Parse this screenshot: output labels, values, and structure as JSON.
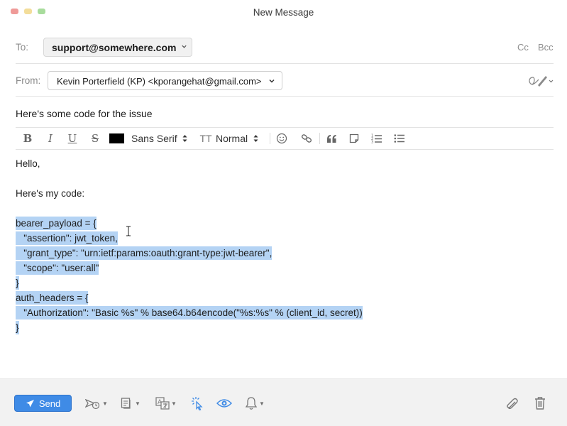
{
  "window": {
    "title": "New Message"
  },
  "to": {
    "label": "To:",
    "recipient": "support@somewhere.com",
    "cc_label": "Cc",
    "bcc_label": "Bcc"
  },
  "from": {
    "label": "From:",
    "account": "Kevin Porterfield (KP) <kporangehat@gmail.com>"
  },
  "subject": {
    "value": "Here's some code for the issue"
  },
  "format_toolbar": {
    "bold": "B",
    "italic": "I",
    "underline": "U",
    "strike": "S",
    "text_color": "#000000",
    "font": "Sans Serif",
    "size_icon_label": "TT",
    "size": "Normal"
  },
  "message": {
    "greeting": "Hello,",
    "intro": "Here's my code:",
    "code_lines": [
      "bearer_payload = {",
      "   \"assertion\": jwt_token,",
      "   \"grant_type\": \"urn:ietf:params:oauth:grant-type:jwt-bearer\",",
      "   \"scope\": \"user:all\"",
      "}",
      "auth_headers = {",
      "   \"Authorization\": \"Basic %s\" % base64.b64encode(\"%s:%s\" % (client_id, secret))",
      "}"
    ]
  },
  "footer": {
    "send_label": "Send"
  },
  "colors": {
    "accent": "#3f8be6",
    "selection": "#b4d3f4"
  }
}
